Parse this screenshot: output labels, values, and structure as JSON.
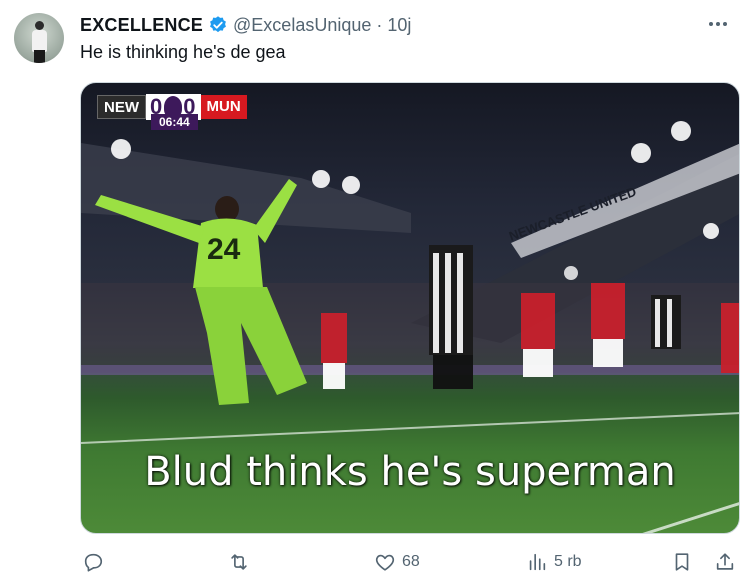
{
  "tweet": {
    "display_name": "EXCELLENCE",
    "handle": "@ExcelasUnique",
    "separator": "·",
    "time_ago": "10j",
    "text": "He is thinking he's de gea",
    "verified_color": "#1d9bf0"
  },
  "media": {
    "scoreboard": {
      "home": "NEW",
      "score": "0-0",
      "home_score": "0",
      "away_score": "0",
      "away": "MUN",
      "clock": "06:44",
      "league_color": "#3d195b",
      "away_color": "#d71920"
    },
    "caption": "Blud thinks he's superman",
    "keeper_number": "24",
    "stand_text": "NEWCASTLE UNITED"
  },
  "actions": {
    "reply_icon": "reply-icon",
    "retweet_icon": "retweet-icon",
    "like_icon": "heart-icon",
    "like_count": "68",
    "views_icon": "views-icon",
    "views_count": "5 rb",
    "bookmark_icon": "bookmark-icon",
    "share_icon": "share-icon"
  }
}
